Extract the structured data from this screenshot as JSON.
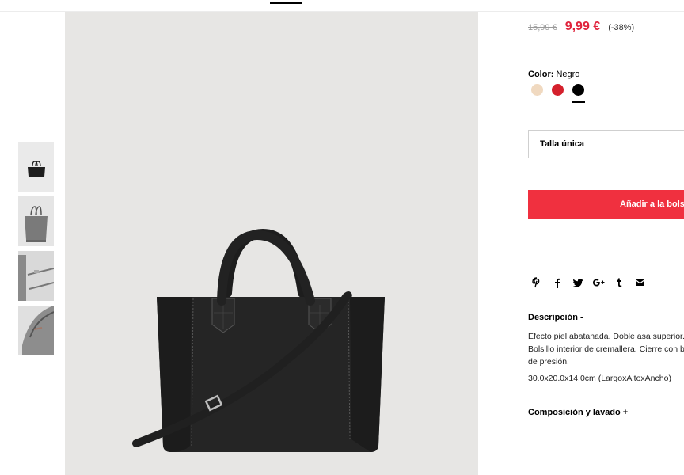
{
  "price": {
    "old": "15,99 €",
    "current": "9,99 €",
    "discount": "(-38%)"
  },
  "color": {
    "label": "Color:",
    "selected": "Negro",
    "swatches": [
      {
        "name": "beige",
        "hex": "#f0d9c0"
      },
      {
        "name": "rojo",
        "hex": "#d4202c"
      },
      {
        "name": "negro",
        "hex": "#000000",
        "selected": true
      }
    ]
  },
  "size": {
    "value": "Talla única"
  },
  "cart": {
    "add_label": "Añadir a la bolsa"
  },
  "share": {
    "icons": [
      "pinterest-icon",
      "facebook-icon",
      "twitter-icon",
      "google-plus-icon",
      "tumblr-icon",
      "email-icon"
    ],
    "glyphs": [
      "𝓅",
      "f",
      "🐦",
      "G+",
      "t",
      "✉"
    ]
  },
  "description": {
    "title": "Descripción -",
    "text": "Efecto piel abatanada. Doble asa superior. Bolsillo interior de cremallera. Cierre con botón de presión.",
    "dimensions": "30.0x20.0x14.0cm (LargoxAltoxAncho)"
  },
  "composition": {
    "title": "Composición y lavado +"
  },
  "theme": {
    "accent": "#f0303f",
    "price_red": "#e0233c",
    "image_bg": "#e7e6e4"
  }
}
